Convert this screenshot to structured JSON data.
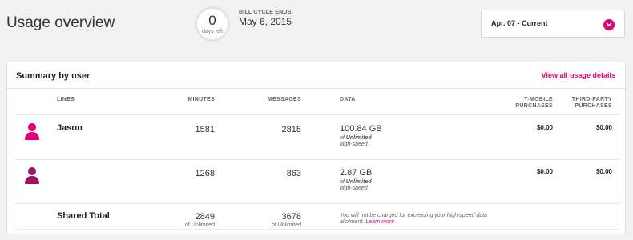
{
  "header": {
    "title": "Usage overview",
    "days_left": {
      "value": "0",
      "label": "days left"
    },
    "bill_cycle": {
      "label": "BILL CYCLE ENDS:",
      "date": "May 6, 2015"
    },
    "period_select": {
      "value": "Apr. 07 - Current"
    }
  },
  "summary": {
    "title": "Summary by user",
    "link": "View all usage details",
    "columns": {
      "lines": "LINES",
      "minutes": "MINUTES",
      "messages": "MESSAGES",
      "data": "DATA",
      "tmobile_line1": "T-MOBILE",
      "tmobile_line2": "PURCHASES",
      "third_line1": "THIRD-PARTY",
      "third_line2": "PURCHASES"
    },
    "rows": [
      {
        "name": "Jason",
        "minutes": "1581",
        "messages": "2815",
        "data": "100.84 GB",
        "data_of": "of ",
        "data_limit": "Unlimited",
        "data_speed": "high-speed",
        "tmobile": "$0.00",
        "third_party": "$0.00"
      },
      {
        "name": "",
        "minutes": "1268",
        "messages": "863",
        "data": "2.87 GB",
        "data_of": "of ",
        "data_limit": "Unlimited",
        "data_speed": "high-speed",
        "tmobile": "$0.00",
        "third_party": "$0.00"
      }
    ],
    "total": {
      "label": "Shared Total",
      "minutes": "2849",
      "minutes_sub": "of Unlimited",
      "messages": "3678",
      "messages_sub": "of Unlimited",
      "note": "You will not be charged for exceeding your high-speed data allotment.",
      "note_link": "Learn more"
    }
  },
  "colors": {
    "accent": "#e20074",
    "user_icon_primary": "#e20074",
    "user_icon_secondary": "#9b1462"
  },
  "icons": {
    "user": "user-icon",
    "chevron": "chevron-down-icon"
  }
}
